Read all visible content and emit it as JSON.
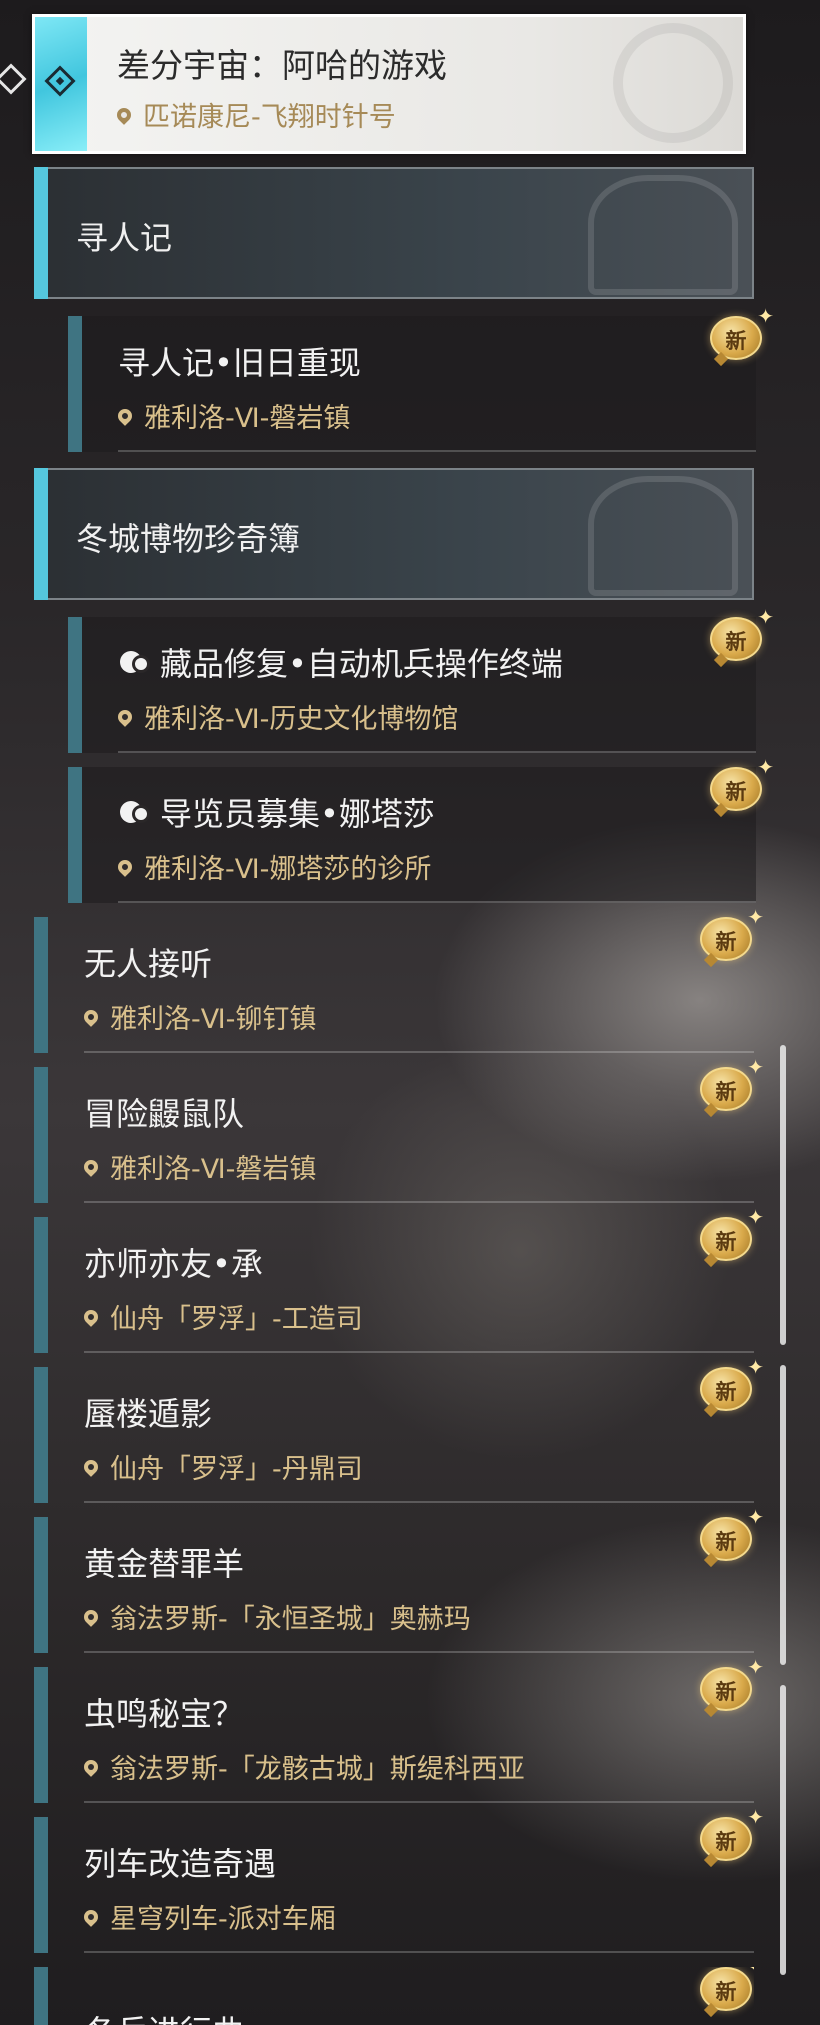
{
  "selected": {
    "title": "差分宇宙：阿哈的游戏",
    "location": "匹诺康尼-飞翔时针号"
  },
  "categories": [
    {
      "label": "寻人记",
      "quests": [
        {
          "title": "寻人记•旧日重现",
          "location": "雅利洛-Ⅵ-磐岩镇",
          "badge": "新"
        }
      ]
    },
    {
      "label": "冬城博物珍奇簿",
      "quests": [
        {
          "title": "藏品修复•自动机兵操作终端",
          "location": "雅利洛-Ⅵ-历史文化博物馆",
          "badge": "新"
        },
        {
          "title": "导览员募集•娜塔莎",
          "location": "雅利洛-Ⅵ-娜塔莎的诊所",
          "badge": "新"
        }
      ]
    }
  ],
  "quests": [
    {
      "title": "无人接听",
      "location": "雅利洛-Ⅵ-铆钉镇",
      "badge": "新"
    },
    {
      "title": "冒险鼹鼠队",
      "location": "雅利洛-Ⅵ-磐岩镇",
      "badge": "新"
    },
    {
      "title": "亦师亦友•承",
      "location": "仙舟「罗浮」-工造司",
      "badge": "新"
    },
    {
      "title": "蜃楼遁影",
      "location": "仙舟「罗浮」-丹鼎司",
      "badge": "新"
    },
    {
      "title": "黄金替罪羊",
      "location": "翁法罗斯-「永恒圣城」奥赫玛",
      "badge": "新"
    },
    {
      "title": "虫鸣秘宝？",
      "location": "翁法罗斯-「龙骸古城」斯缇科西亚",
      "badge": "新"
    },
    {
      "title": "列车改造奇遇",
      "location": "星穹列车-派对车厢",
      "badge": "新"
    },
    {
      "title": "冬兵进行曲",
      "location": "",
      "badge": "新"
    }
  ],
  "icons": {
    "location": "map-pin-icon",
    "event": "event-quest-icon",
    "selected": "diamond-quest-icon",
    "pointer": "selection-pointer-icon"
  },
  "colors": {
    "accent_cyan": "#55c7dd",
    "row_bar": "#3f7482",
    "location_gold": "#d9c08c",
    "badge_gold": "#d9a94a"
  }
}
